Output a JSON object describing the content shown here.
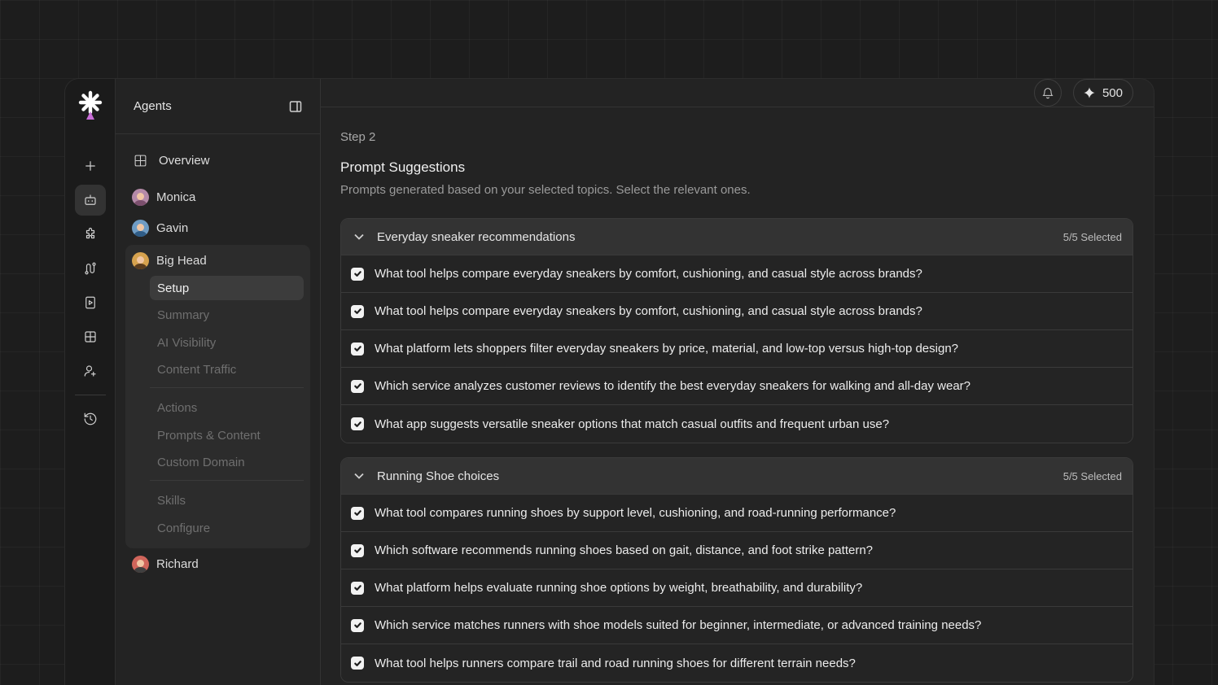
{
  "sidebar": {
    "title": "Agents",
    "overview_label": "Overview",
    "agents": [
      {
        "name": "Monica",
        "color": "#b48aa8"
      },
      {
        "name": "Gavin",
        "color": "#6f9cc4"
      },
      {
        "name": "Big Head",
        "color": "#d6a24e"
      },
      {
        "name": "Richard",
        "color": "#d0655b"
      }
    ],
    "sub_items": [
      "Setup",
      "Summary",
      "AI Visibility",
      "Content Traffic",
      "Actions",
      "Prompts & Content",
      "Custom Domain",
      "Skills",
      "Configure"
    ]
  },
  "rail": {
    "icons": [
      "plus-icon",
      "bot-icon",
      "puzzle-icon",
      "route-icon",
      "play-file-icon",
      "grid-icon",
      "user-plus-icon",
      "history-icon"
    ]
  },
  "topbar": {
    "credits": "500"
  },
  "main": {
    "step": "Step 2",
    "title": "Prompt Suggestions",
    "subtitle": "Prompts generated based on your selected topics. Select the relevant ones.",
    "groups": [
      {
        "title": "Everyday sneaker recommendations",
        "count": "5/5 Selected",
        "prompts": [
          "What tool helps compare everyday sneakers by comfort, cushioning, and casual style across brands?",
          "What tool helps compare everyday sneakers by comfort, cushioning, and casual style across brands?",
          "What platform lets shoppers filter everyday sneakers by price, material, and low-top versus high-top design?",
          "Which service analyzes customer reviews to identify the best everyday sneakers for walking and all-day wear?",
          "What app suggests versatile sneaker options that match casual outfits and frequent urban use?"
        ]
      },
      {
        "title": "Running Shoe choices",
        "count": "5/5 Selected",
        "prompts": [
          "What tool compares running shoes by support level, cushioning, and road-running performance?",
          "Which software recommends running shoes based on gait, distance, and foot strike pattern?",
          "What platform helps evaluate running shoe options by weight, breathability, and durability?",
          "Which service matches runners with shoe models suited for beginner, intermediate, or advanced training needs?",
          "What tool helps runners compare trail and road running shoes for different terrain needs?"
        ]
      }
    ]
  }
}
